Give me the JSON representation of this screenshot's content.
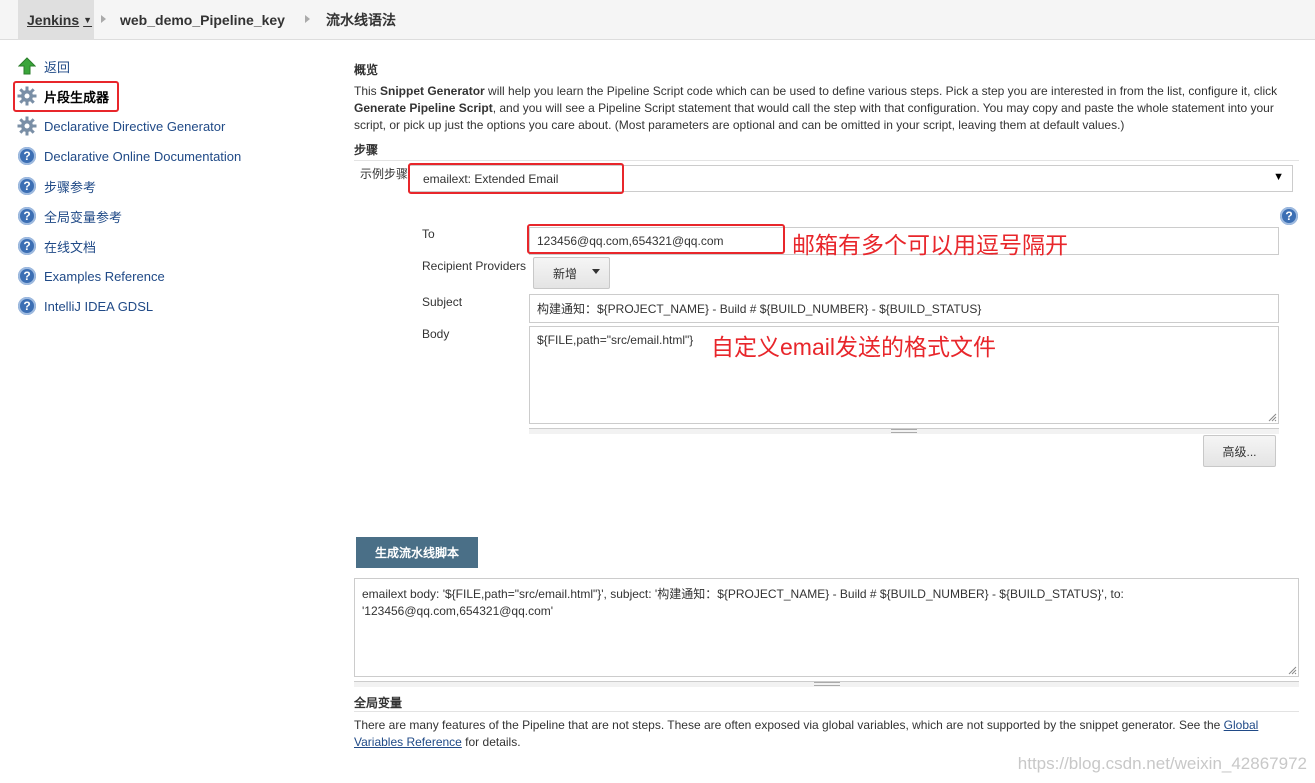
{
  "breadcrumb": {
    "jenkins": "Jenkins",
    "job": "web_demo_Pipeline_key",
    "page": "流水线语法"
  },
  "sidebar": {
    "items": [
      {
        "label": "返回",
        "icon": "arrow-up-icon"
      },
      {
        "label": "片段生成器",
        "icon": "gear-icon"
      },
      {
        "label": "Declarative Directive Generator",
        "icon": "gear-icon"
      },
      {
        "label": "Declarative Online Documentation",
        "icon": "help-icon"
      },
      {
        "label": "步骤参考",
        "icon": "help-icon"
      },
      {
        "label": "全局变量参考",
        "icon": "help-icon"
      },
      {
        "label": "在线文档",
        "icon": "help-icon"
      },
      {
        "label": "Examples Reference",
        "icon": "help-icon"
      },
      {
        "label": "IntelliJ IDEA GDSL",
        "icon": "help-icon"
      }
    ]
  },
  "overview": {
    "heading": "概览",
    "p1": "This ",
    "b1": "Snippet Generator",
    "p2": " will help you learn the Pipeline Script code which can be used to define various steps. Pick a step you are interested in from the list, configure it, click ",
    "b2": "Generate Pipeline Script",
    "p3": ", and you will see a Pipeline Script statement that would call the step with that configuration. You may copy and paste the whole statement into your script, or pick up just the options you care about. (Most parameters are optional and can be omitted in your script, leaving them at default values.)"
  },
  "steps": {
    "heading": "步骤",
    "sample_label": "示例步骤",
    "selected": "emailext: Extended Email"
  },
  "form": {
    "to_label": "To",
    "to_value": "123456@qq.com,654321@qq.com",
    "providers_label": "Recipient Providers",
    "add_button": "新增",
    "subject_label": "Subject",
    "subject_value": "构建通知：${PROJECT_NAME} - Build # ${BUILD_NUMBER} - ${BUILD_STATUS}",
    "body_label": "Body",
    "body_value": "${FILE,path=\"src/email.html\"}",
    "advanced_button": "高级..."
  },
  "annotations": {
    "to_note": "邮箱有多个可以用逗号隔开",
    "body_note": "自定义email发送的格式文件"
  },
  "generate": {
    "button": "生成流水线脚本",
    "output": "emailext body: '${FILE,path=\"src/email.html\"}', subject: '构建通知：${PROJECT_NAME} - Build # ${BUILD_NUMBER} - ${BUILD_STATUS}', to: '123456@qq.com,654321@qq.com'"
  },
  "globals": {
    "heading": "全局变量",
    "text1": "There are many features of the Pipeline that are not steps. These are often exposed via global variables, which are not supported by the snippet generator. See the ",
    "link": "Global Variables Reference",
    "text2": " for details."
  },
  "watermark": "https://blog.csdn.net/weixin_42867972",
  "colors": {
    "annotation_red": "#e8262b",
    "link_blue": "#204a87",
    "generate_button": "#4a6f87"
  }
}
